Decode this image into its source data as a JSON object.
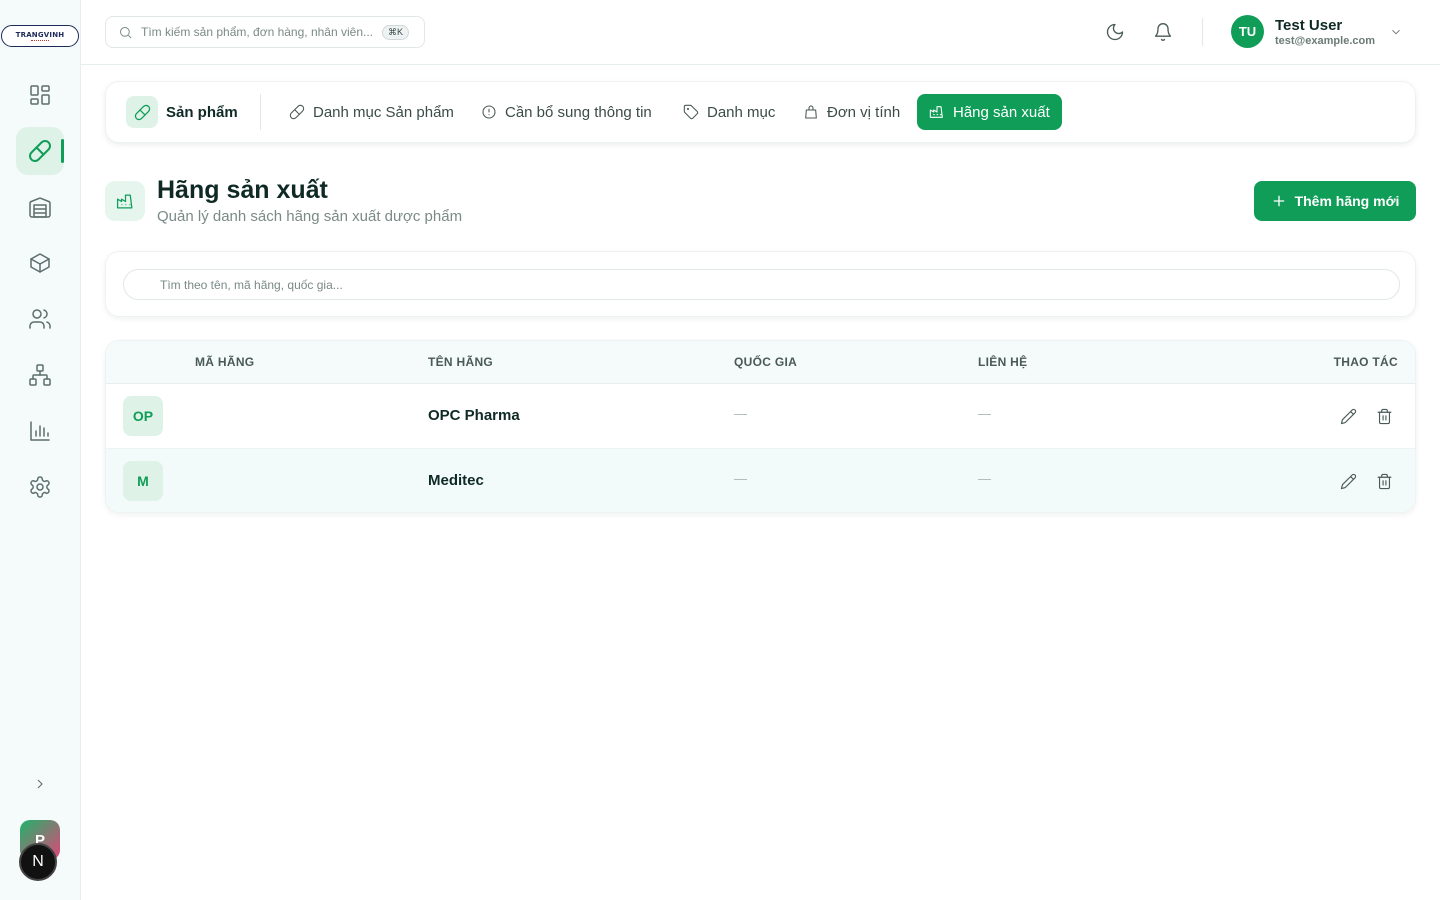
{
  "app": {
    "logo_text": "TRANGVINH",
    "avatar_letter": "P",
    "badge_letter": "N"
  },
  "topbar": {
    "search_placeholder": "Tìm kiếm sản phẩm, đơn hàng, nhân viên...",
    "search_shortcut": "⌘K",
    "user": {
      "initials": "TU",
      "name": "Test User",
      "email": "test@example.com"
    }
  },
  "tabs": {
    "home_label": "Sản phẩm",
    "items": [
      {
        "label": "Danh mục Sản phẩm",
        "icon": "pill-icon"
      },
      {
        "label": "Cần bổ sung thông tin",
        "icon": "alert-circle-icon"
      },
      {
        "label": "Danh mục",
        "icon": "tag-icon"
      },
      {
        "label": "Đơn vị tính",
        "icon": "bag-icon"
      },
      {
        "label": "Hãng sản xuất",
        "icon": "factory-icon",
        "active": true
      }
    ]
  },
  "page": {
    "title": "Hãng sản xuất",
    "subtitle": "Quản lý danh sách hãng sản xuất dược phẩm",
    "add_button": "Thêm hãng mới",
    "filter_placeholder": "Tìm theo tên, mã hãng, quốc gia..."
  },
  "table": {
    "columns": [
      "MÃ HÃNG",
      "TÊN HÃNG",
      "QUỐC GIA",
      "LIÊN HỆ",
      "THAO TÁC"
    ],
    "rows": [
      {
        "code_badge": "OP",
        "name": "OPC Pharma",
        "country": "—",
        "contact": "—"
      },
      {
        "code_badge": "M",
        "name": "Meditec",
        "country": "—",
        "contact": "—"
      }
    ]
  },
  "colors": {
    "accent": "#0f9d58",
    "accent_soft": "#dff2e8",
    "sidebar_bg": "#f5fafa"
  }
}
